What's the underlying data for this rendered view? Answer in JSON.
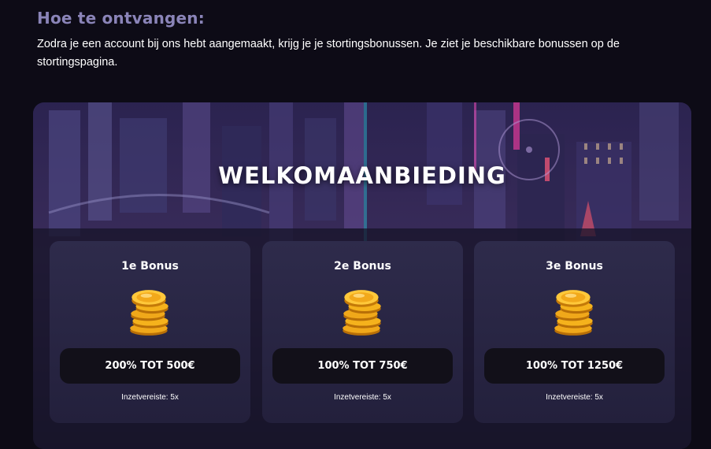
{
  "section": {
    "heading": "Hoe te ontvangen:",
    "intro": "Zodra je een account bij ons hebt aangemaakt, krijg je je stortingsbonussen. Je ziet je beschikbare bonussen op de stortingspagina."
  },
  "promo": {
    "title": "WELKOMAANBIEDING",
    "cards": [
      {
        "title": "1e Bonus",
        "amount": "200% TOT 500€",
        "wager": "Inzetvereiste: 5x",
        "icon": "coins-icon"
      },
      {
        "title": "2e Bonus",
        "amount": "100% TOT 750€",
        "wager": "Inzetvereiste: 5x",
        "icon": "coins-icon"
      },
      {
        "title": "3e Bonus",
        "amount": "100% TOT 1250€",
        "wager": "Inzetvereiste: 5x",
        "icon": "coins-icon"
      }
    ]
  },
  "colors": {
    "page_background": "#0d0b16",
    "heading": "#8a84b8",
    "card": "#2a2746",
    "pill": "#121019",
    "coin": "#f5b21c"
  }
}
